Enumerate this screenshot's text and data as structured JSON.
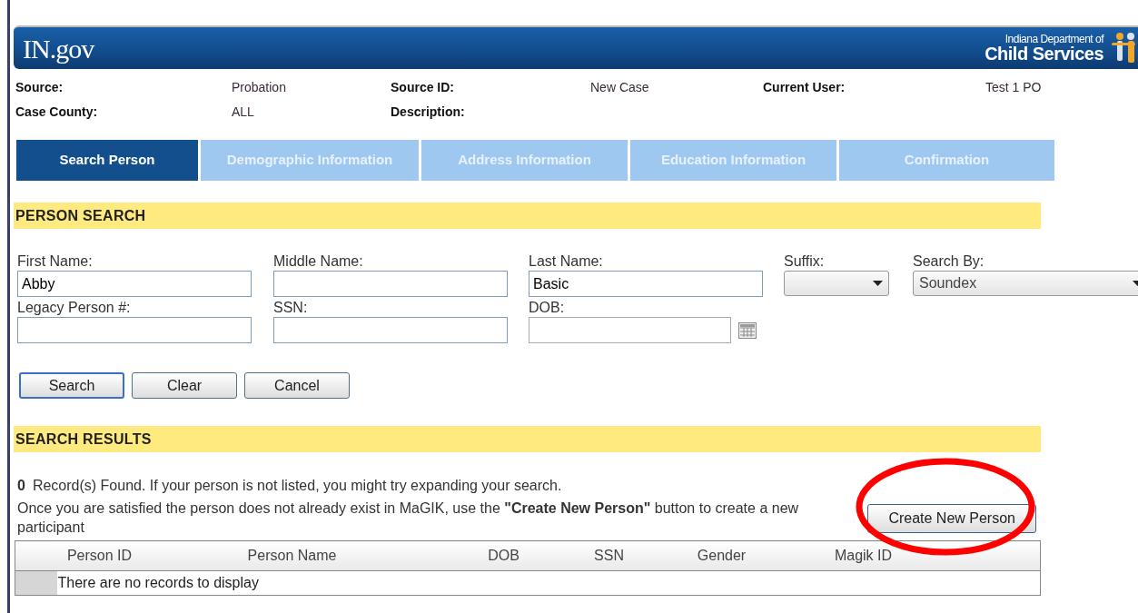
{
  "header": {
    "logo": "IN.gov",
    "agency_line1": "Indiana Department of",
    "agency_line2": "Child Services"
  },
  "info": [
    {
      "label": "Source:",
      "value": "Probation"
    },
    {
      "label": "Source ID:",
      "value": "New Case"
    },
    {
      "label": "Current User:",
      "value": "Test 1 PO"
    },
    {
      "label": "Case County:",
      "value": "ALL"
    },
    {
      "label": "Description:"
    }
  ],
  "tabs": [
    {
      "label": "Search Person",
      "selected": true
    },
    {
      "label": "Demographic Information",
      "selected": false
    },
    {
      "label": "Address Information",
      "selected": false
    },
    {
      "label": "Education Information",
      "selected": false
    },
    {
      "label": "Confirmation",
      "selected": false
    }
  ],
  "person_search": {
    "title": "PERSON SEARCH",
    "fields": [
      {
        "kind": "text",
        "label": "First Name:",
        "value": "Abby"
      },
      {
        "kind": "text",
        "label": "Middle Name:"
      },
      {
        "kind": "text",
        "label": "Last Name:",
        "value": "Basic"
      },
      {
        "kind": "select",
        "label": "Suffix:"
      },
      {
        "kind": "select",
        "label": "Search By:",
        "value": "Soundex"
      },
      {
        "kind": "text",
        "label": "Legacy Person #:"
      },
      {
        "kind": "text",
        "label": "SSN:"
      },
      {
        "kind": "date",
        "label": "DOB:"
      }
    ],
    "buttons": [
      {
        "label": "Search",
        "default": true
      },
      {
        "label": "Clear",
        "default": false
      },
      {
        "label": "Cancel",
        "default": false
      }
    ]
  },
  "search_results": {
    "title": "SEARCH RESULTS",
    "count": "0",
    "message": "Record(s) Found. If your person is not listed, you might try expanding your search.",
    "instruction": "Once you are satisfied the person does not already exist in MaGIK, use the **\"Create New Person\"** button to create a new participant",
    "create_button": "Create New Person",
    "table": {
      "columns": [
        "Person ID",
        "Person Name",
        "DOB",
        "SSN",
        "Gender",
        "Magik ID"
      ],
      "empty_message": "There are no records to display"
    }
  },
  "annotation": {
    "kind": "ellipse",
    "color": "#ff0000"
  }
}
